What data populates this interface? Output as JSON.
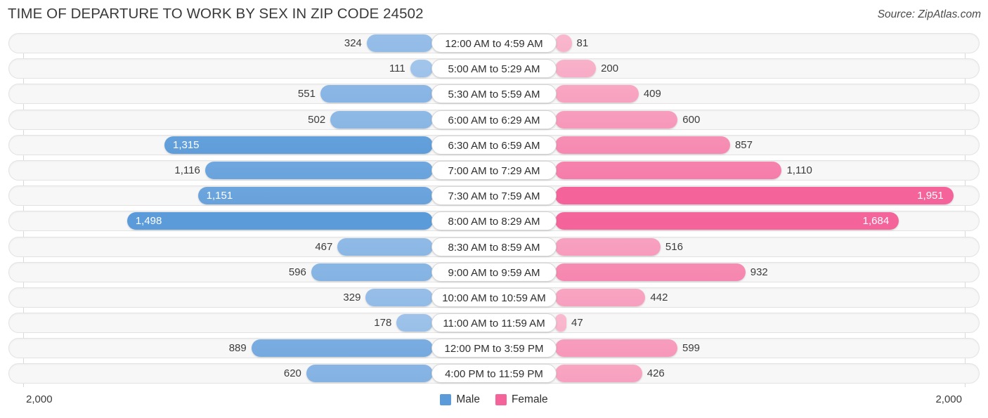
{
  "header": {
    "title": "TIME OF DEPARTURE TO WORK BY SEX IN ZIP CODE 24502",
    "source": "Source: ZipAtlas.com"
  },
  "footer": {
    "axis_max_left": "2,000",
    "axis_max_right": "2,000",
    "legend": [
      {
        "label": "Male",
        "color": "#5b9bd9"
      },
      {
        "label": "Female",
        "color": "#f4649a"
      }
    ]
  },
  "colors": {
    "male_light": "#a8c8ec",
    "male_dark": "#5b9bd9",
    "female_light": "#f9bcd0",
    "female_dark": "#f4649a",
    "track": "#f7f7f7",
    "gridline": "#d9d9d9"
  },
  "chart_data": {
    "type": "bar",
    "subtype": "diverging-butterfly",
    "title": "TIME OF DEPARTURE TO WORK BY SEX IN ZIP CODE 24502",
    "xlabel": "",
    "ylabel": "",
    "xlim": [
      2000,
      2000
    ],
    "axis_max": 2000,
    "grid": true,
    "legend_position": "bottom-center",
    "categories": [
      "12:00 AM to 4:59 AM",
      "5:00 AM to 5:29 AM",
      "5:30 AM to 5:59 AM",
      "6:00 AM to 6:29 AM",
      "6:30 AM to 6:59 AM",
      "7:00 AM to 7:29 AM",
      "7:30 AM to 7:59 AM",
      "8:00 AM to 8:29 AM",
      "8:30 AM to 8:59 AM",
      "9:00 AM to 9:59 AM",
      "10:00 AM to 10:59 AM",
      "11:00 AM to 11:59 AM",
      "12:00 PM to 3:59 PM",
      "4:00 PM to 11:59 PM"
    ],
    "series": [
      {
        "name": "Male",
        "direction": "left",
        "color": "#5b9bd9",
        "values": [
          324,
          111,
          551,
          502,
          1315,
          1116,
          1151,
          1498,
          467,
          596,
          329,
          178,
          889,
          620
        ],
        "labels": [
          "324",
          "111",
          "551",
          "502",
          "1,315",
          "1,116",
          "1,151",
          "1,498",
          "467",
          "596",
          "329",
          "178",
          "889",
          "620"
        ]
      },
      {
        "name": "Female",
        "direction": "right",
        "color": "#f4649a",
        "values": [
          81,
          200,
          409,
          600,
          857,
          1110,
          1951,
          1684,
          516,
          932,
          442,
          47,
          599,
          426
        ],
        "labels": [
          "81",
          "200",
          "409",
          "600",
          "857",
          "1,110",
          "1,951",
          "1,684",
          "516",
          "932",
          "442",
          "47",
          "599",
          "426"
        ]
      }
    ]
  }
}
